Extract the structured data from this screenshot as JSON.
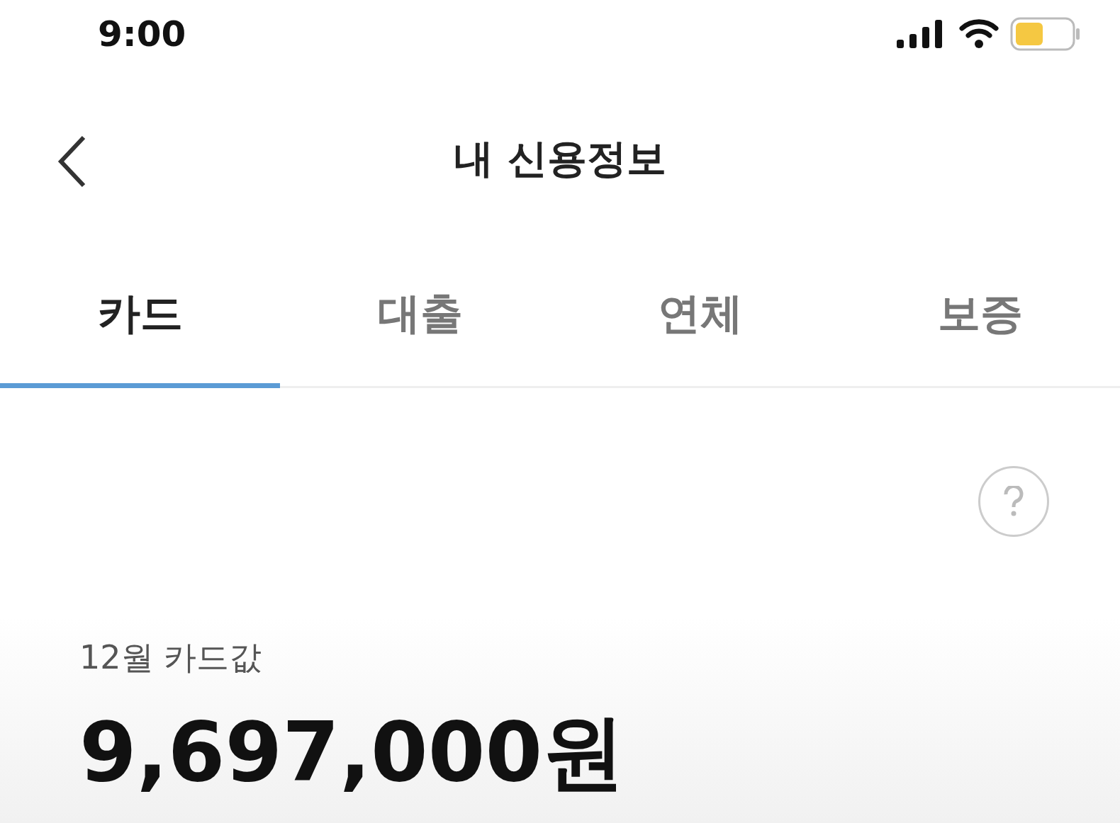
{
  "status_bar": {
    "time": "9:00"
  },
  "header": {
    "title": "내 신용정보"
  },
  "tabs": [
    {
      "label": "카드",
      "selected": true
    },
    {
      "label": "대출",
      "selected": false
    },
    {
      "label": "연체",
      "selected": false
    },
    {
      "label": "보증",
      "selected": false
    }
  ],
  "summary": {
    "label": "12월 카드값",
    "amount": "9,697,000원"
  }
}
